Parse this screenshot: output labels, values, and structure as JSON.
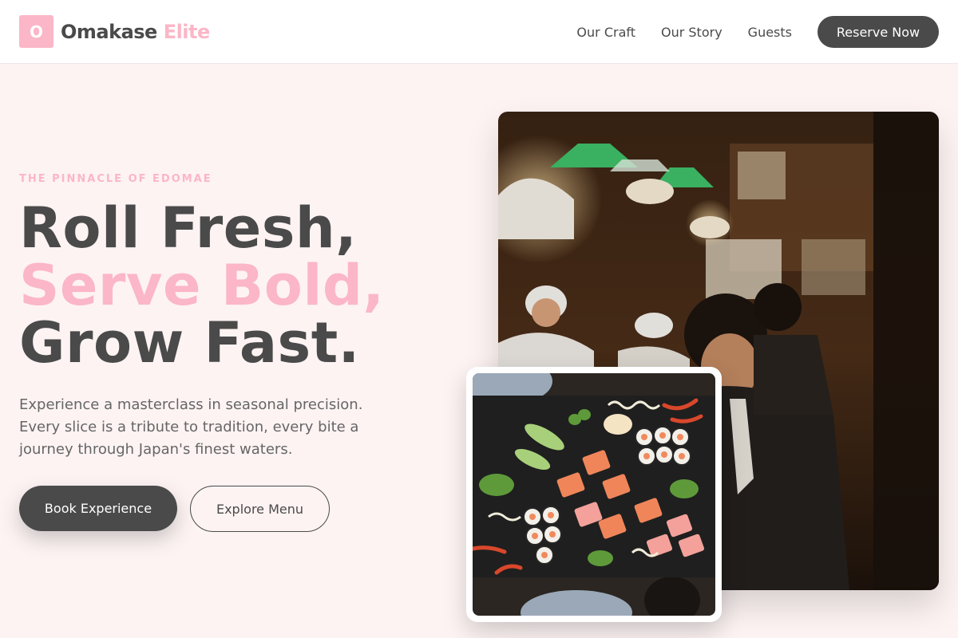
{
  "header": {
    "logo_mark": "O",
    "brand_primary": "Omakase",
    "brand_accent": "Elite",
    "nav": [
      "Our Craft",
      "Our Story",
      "Guests"
    ],
    "cta": "Reserve Now"
  },
  "hero": {
    "eyebrow": "THE PINNACLE OF EDOMAE",
    "headline_line1": "Roll Fresh,",
    "headline_line2": "Serve Bold,",
    "headline_line3": "Grow Fast.",
    "description": "Experience a masterclass in seasonal precision. Every slice is a tribute to tradition, every bite a journey through Japan's finest waters.",
    "primary_button": "Book Experience",
    "secondary_button": "Explore Menu"
  },
  "images": {
    "main_photo": "sushi-bar-chefs-photo",
    "card_photo": "sushi-platter-photo"
  },
  "colors": {
    "accent": "#fbb6c7",
    "dark": "#4a4a4a",
    "background": "#fdf3f3"
  }
}
